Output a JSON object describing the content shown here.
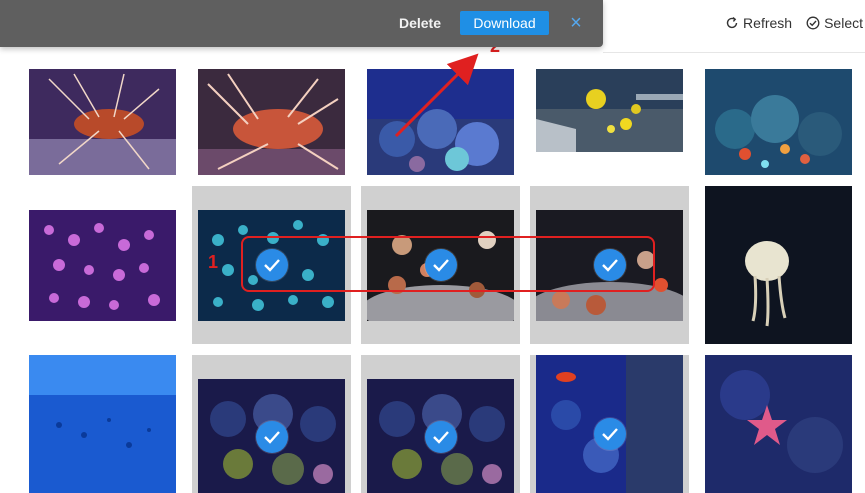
{
  "action_bar": {
    "delete_label": "Delete",
    "download_label": "Download",
    "close_icon": "×"
  },
  "toolbar": {
    "refresh_label": "Refresh",
    "select_label": "Select"
  },
  "annotations": {
    "step1": "1",
    "step2": "2"
  },
  "colors": {
    "accent": "#1f8fe5",
    "annotation": "#e02020",
    "action_bar_bg": "#5f5f5f",
    "selected_bg": "#d0d0d0"
  },
  "photos": [
    {
      "id": "lionfish-1",
      "selected": false
    },
    {
      "id": "lionfish-2",
      "selected": false
    },
    {
      "id": "reef-blue",
      "selected": false
    },
    {
      "id": "reef-yellow-fish",
      "selected": false
    },
    {
      "id": "reef-colorful",
      "selected": false
    },
    {
      "id": "jellyfish-purple",
      "selected": false
    },
    {
      "id": "jellyfish-teal",
      "selected": true
    },
    {
      "id": "anemones-1",
      "selected": true
    },
    {
      "id": "anemones-2",
      "selected": true
    },
    {
      "id": "jellyfish-single",
      "selected": false
    },
    {
      "id": "tank-blue",
      "selected": false
    },
    {
      "id": "reef-coral-1",
      "selected": true
    },
    {
      "id": "reef-coral-2",
      "selected": true
    },
    {
      "id": "reef-red-fish",
      "selected": true
    },
    {
      "id": "starfish",
      "selected": false
    }
  ]
}
